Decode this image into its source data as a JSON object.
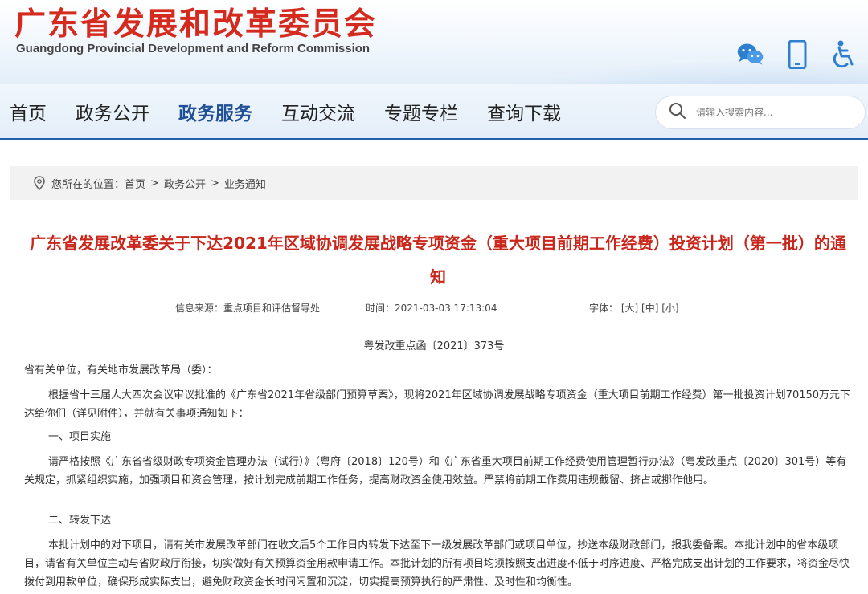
{
  "header": {
    "title": "广东省发展和改革委员会",
    "subtitle": "Guangdong Provincial Development and Reform Commission",
    "icons": [
      "wechat-icon",
      "mobile-icon",
      "accessibility-icon"
    ]
  },
  "nav": {
    "items": [
      {
        "label": "首页"
      },
      {
        "label": "政务公开"
      },
      {
        "label": "政务服务",
        "active": true
      },
      {
        "label": "互动交流"
      },
      {
        "label": "专题专栏"
      },
      {
        "label": "查询下载"
      }
    ],
    "search_placeholder": "请输入搜索内容...",
    "accent": "#1f5fae"
  },
  "breadcrumb": {
    "prefix": "您所在的位置：",
    "items": [
      "首页",
      "政务公开",
      "业务通知"
    ],
    "separator": ">"
  },
  "article": {
    "title": "广东省发展改革委关于下达2021年区域协调发展战略专项资金（重大项目前期工作经费）投资计划（第一批）的通知",
    "source_label": "信息来源：重点项目和评估督导处",
    "time_label": "时间：2021-03-03 17:13:04",
    "font_size_label": "字体：",
    "font_sizes": [
      "[大]",
      "[中]",
      "[小]"
    ],
    "doc_number": "粤发改重点函〔2021〕373号",
    "greeting": "省有关单位，有关地市发展改革局（委）：",
    "intro": "根据省十三届人大四次会议审议批准的《广东省2021年省级部门预算草案》，现将2021年区域协调发展战略专项资金（重大项目前期工作经费）第一批投资计划70150万元下达给你们（详见附件），并就有关事项通知如下：",
    "section1_heading": "一、项目实施",
    "section1_text": "请严格按照《广东省省级财政专项资金管理办法（试行）》（粤府〔2018〕120号）和《广东省重大项目前期工作经费使用管理暂行办法》（粤发改重点〔2020〕301号）等有关规定，抓紧组织实施，加强项目和资金管理，按计划完成前期工作任务，提高财政资金使用效益。严禁将前期工作费用违规截留、挤占或挪作他用。",
    "section2_heading": "二、转发下达",
    "section2_text": "本批计划中的对下项目，请有关市发展改革部门在收文后5个工作日内转发下达至下一级发展改革部门或项目单位，抄送本级财政部门，报我委备案。本批计划中的省本级项目，请省有关单位主动与省财政厅衔接，切实做好有关预算资金用款申请工作。本批计划的所有项目均须按照支出进度不低于时序进度、严格完成支出计划的工作要求，将资金尽快拨付到用款单位，确保形成实际支出，避免财政资金长时间闲置和沉淀，切实提高预算执行的严肃性、及时性和均衡性。",
    "title_color": "#c9271c"
  }
}
